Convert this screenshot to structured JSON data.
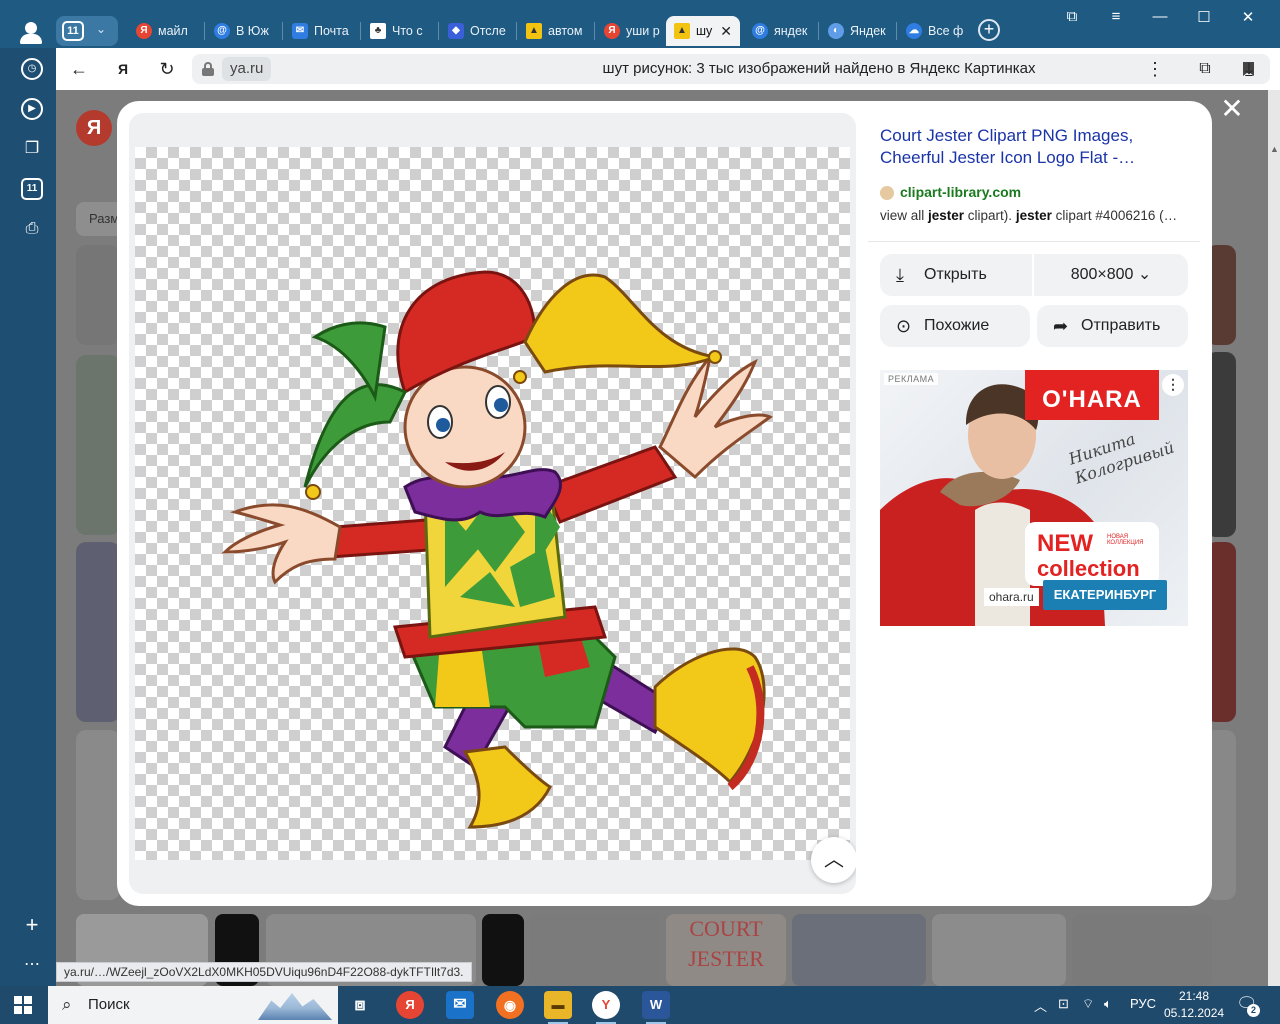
{
  "tab_counter": "11",
  "tabs": [
    {
      "label": "майл",
      "icon": "yandex-icon",
      "color": "#e64533"
    },
    {
      "label": "В Юж",
      "icon": "mail-at-icon",
      "color": "#2f7de1"
    },
    {
      "label": "Почта",
      "icon": "envelope-icon",
      "color": "#2f7de1"
    },
    {
      "label": "Что с",
      "icon": "puzzle-icon",
      "color": "#ffffff"
    },
    {
      "label": "Отсле",
      "icon": "cube-icon",
      "color": "#3a5fd9"
    },
    {
      "label": "автом",
      "icon": "image-icon",
      "color": "#f3c312"
    },
    {
      "label": "уши р",
      "icon": "yandex-icon",
      "color": "#e64533"
    },
    {
      "label": "шу",
      "icon": "image-icon",
      "color": "#f3c312"
    },
    {
      "label": "яндек",
      "icon": "mail-at-icon",
      "color": "#2f7de1"
    },
    {
      "label": "Яндек",
      "icon": "yandex-disk-icon",
      "color": "#5f9de8"
    },
    {
      "label": "Все ф",
      "icon": "cloud-icon",
      "color": "#2f7de1"
    }
  ],
  "address": {
    "domain": "ya.ru",
    "title": "шут рисунок: 3 тыс изображений найдено в Яндекс Картинках"
  },
  "background_page": {
    "logo_letter": "Я",
    "filter_chip": "Разм",
    "strip_caption": "COURT JESTER"
  },
  "result": {
    "title": "Court Jester Clipart PNG Images, Cheerful Jester Icon Logo Flat -…",
    "source": "clipart-library.com",
    "snippet_parts": [
      "view all ",
      "jester",
      " clipart). ",
      "jester",
      " clipart #4006216 (…"
    ],
    "open_label": "Открыть",
    "size_label": "800×800",
    "similar_label": "Похожие",
    "share_label": "Отправить"
  },
  "ad": {
    "tag": "РЕКЛАМА",
    "menu": "⋮",
    "brand": "O'HARA",
    "signature": "Никита Кологривый",
    "new_label": "NEW",
    "collection_label": "collection",
    "collection_sub": "НОВАЯ КОЛЛЕКЦИЯ",
    "city": "ЕКАТЕРИНБУРГ",
    "domain": "ohara.ru"
  },
  "status_url": "ya.ru/…/WZeejl_zOoVX2LdX0MKH05DVUiqu96nD4F22O88-dykTFTIlt7d3.",
  "taskbar": {
    "search_placeholder": "Поиск",
    "language": "РУС",
    "time": "21:48",
    "date": "05.12.2024",
    "notifications_count": "2"
  },
  "colors": {
    "accent_blue": "#1f5a82",
    "link": "#1a34a8",
    "source_green": "#1b7a1f",
    "ad_red": "#e32222"
  }
}
